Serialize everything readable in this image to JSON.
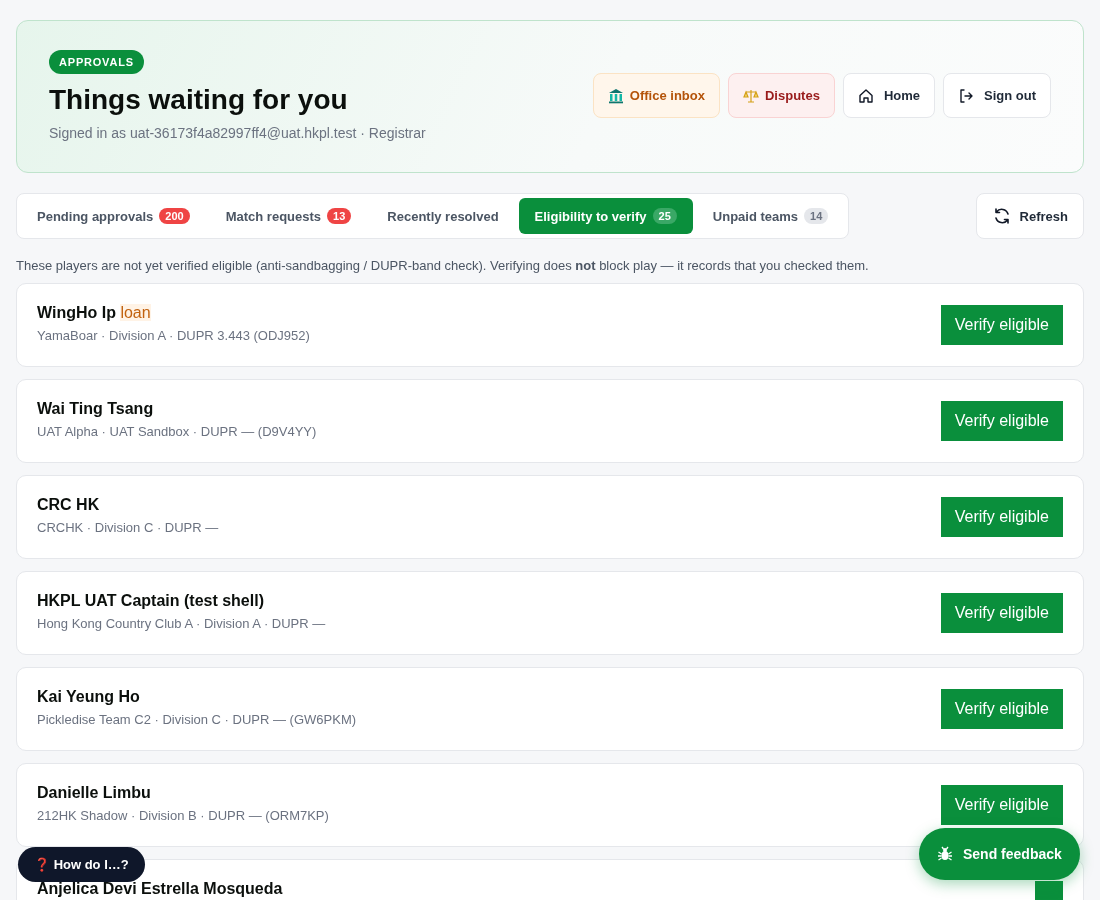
{
  "header": {
    "badge": "APPROVALS",
    "title": "Things waiting for you",
    "subtitle": "Signed in as uat-36173f4a82997ff4@uat.hkpl.test · Registrar",
    "actions": [
      {
        "label": "Office inbox",
        "kind": "office"
      },
      {
        "label": "Disputes",
        "kind": "disputes"
      },
      {
        "label": "Home",
        "kind": "home"
      },
      {
        "label": "Sign out",
        "kind": "signout"
      }
    ]
  },
  "tabs": [
    {
      "label": "Pending approvals",
      "count": "200",
      "color": "#ef4444",
      "selected": false
    },
    {
      "label": "Match requests",
      "count": "13",
      "color": "#ef4444",
      "selected": false
    },
    {
      "label": "Recently resolved",
      "selected": false
    },
    {
      "label": "Eligibility to verify",
      "count": "25",
      "color": "#3aa866",
      "selected": true
    },
    {
      "label": "Unpaid teams",
      "count": "14",
      "color": "#e5e7eb",
      "selected": false
    }
  ],
  "refresh_button": "Refresh",
  "note": "These players are not yet verified eligible (anti-sandbagging / DUPR-band check). Verifying does **not** block play — it records that you checked them.",
  "players": [
    {
      "name": "WingHo Ip",
      "tag": "loan",
      "meta": "YamaBoar · Division A · DUPR 3.443 (ODJ952)",
      "action": "Verify eligible"
    },
    {
      "name": "Wai Ting Tsang",
      "meta": "UAT Alpha · UAT Sandbox · DUPR — (D9V4YY)",
      "action": "Verify eligible"
    },
    {
      "name": "CRC HK",
      "meta": "CRCHK · Division C · DUPR —",
      "action": "Verify eligible"
    },
    {
      "name": "HKPL UAT Captain (test shell)",
      "meta": "Hong Kong Country Club A · Division A · DUPR —",
      "action": "Verify eligible"
    },
    {
      "name": "Kai Yeung Ho",
      "meta": "Pickledise Team C2 · Division C · DUPR — (GW6PKM)",
      "action": "Verify eligible"
    },
    {
      "name": "Danielle Limbu",
      "meta": "212HK Shadow · Division B · DUPR — (ORM7KP)",
      "action": "Verify eligible"
    },
    {
      "name": "Anjelica Devi Estrella Mosqueda"
    }
  ],
  "help_button": {
    "icon": "❓",
    "label": "How do I…?"
  },
  "feedback_button": "Send feedback"
}
